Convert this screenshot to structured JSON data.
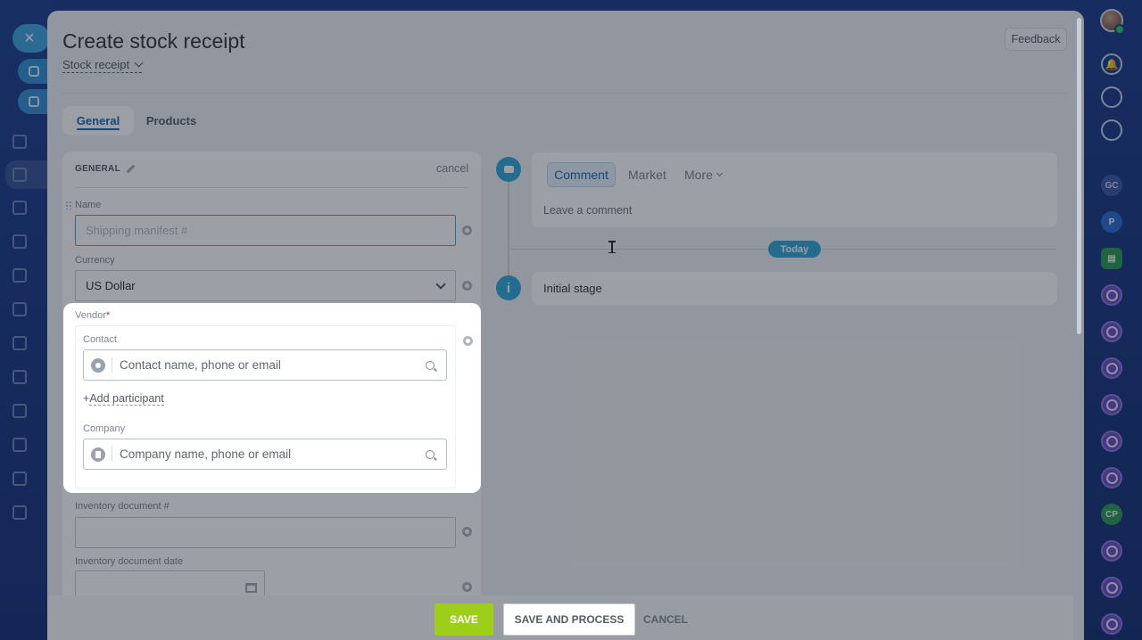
{
  "header": {
    "title": "Create stock receipt",
    "document_type": "Stock receipt",
    "feedback_label": "Feedback"
  },
  "tabs": [
    {
      "label": "General",
      "active": true
    },
    {
      "label": "Products",
      "active": false
    }
  ],
  "section": {
    "title": "GENERAL",
    "cancel_label": "cancel"
  },
  "fields": {
    "name": {
      "label": "Name",
      "value": "",
      "placeholder": "Shipping manifest #"
    },
    "currency": {
      "label": "Currency",
      "value": "US Dollar"
    },
    "vendor": {
      "label": "Vendor",
      "required_mark": "*",
      "contact_label": "Contact",
      "contact_placeholder": "Contact name, phone or email",
      "add_participant": "Add participant",
      "add_prefix": "+",
      "company_label": "Company",
      "company_placeholder": "Company name, phone or email"
    },
    "inventory_doc_number": {
      "label": "Inventory document #",
      "value": ""
    },
    "inventory_doc_date": {
      "label": "Inventory document date",
      "value": ""
    }
  },
  "timeline": {
    "tabs": [
      "Comment",
      "Market",
      "More"
    ],
    "comment_placeholder": "Leave a comment",
    "today_label": "Today",
    "info_icon_glyph": "i",
    "stage_text": "Initial stage"
  },
  "footer": {
    "save": "SAVE",
    "save_and_process": "SAVE AND PROCESS",
    "cancel": "CANCEL"
  },
  "right_rail": {
    "badge_gc": "GC",
    "badge_p": "P",
    "badge_cp": "CP"
  },
  "colors": {
    "accent": "#2067b0",
    "save_button": "#9ece1a",
    "timeline": "#2fa8d6",
    "required": "#d0232e"
  },
  "icons": [
    "close-icon",
    "link-icon",
    "external-icon",
    "bell-icon",
    "gear-icon",
    "search-icon",
    "user-icon",
    "building-icon",
    "calendar-icon",
    "chat-icon",
    "info-icon",
    "pencil-icon"
  ]
}
